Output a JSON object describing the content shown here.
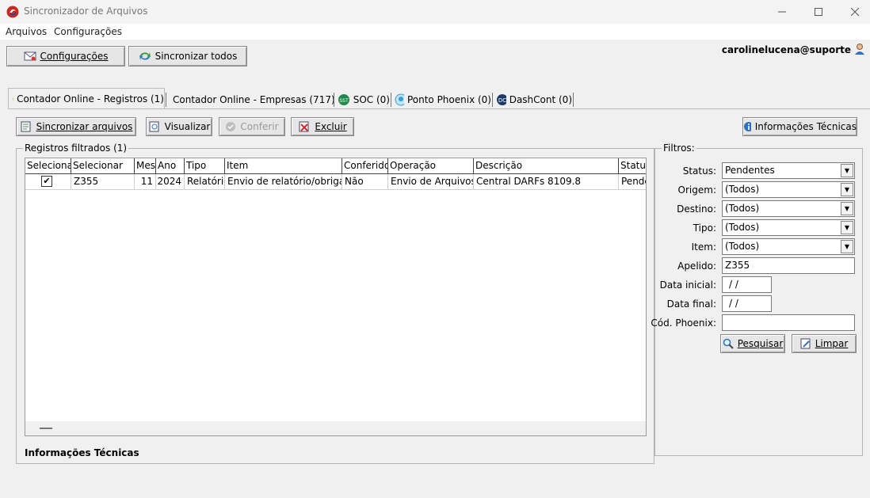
{
  "window": {
    "title": "Sincronizador de Arquivos"
  },
  "menu": [
    "Arquivos",
    "Configurações"
  ],
  "toolbar": {
    "config": "Configurações",
    "sync_all": "Sincronizar todos"
  },
  "user": "carolinelucena@suporte",
  "tabs": [
    {
      "label": "Contador Online - Registros (1)",
      "icon": "smiley-icon"
    },
    {
      "label": "Contador Online - Empresas (717)",
      "icon": "smiley-icon"
    },
    {
      "label": "SOC (0)",
      "icon": "soc-icon"
    },
    {
      "label": "Ponto Phoenix (0)",
      "icon": "phoenix-icon"
    },
    {
      "label": "DashCont (0)",
      "icon": "dashcont-icon"
    }
  ],
  "actions": {
    "sync_files": "Sincronizar arquivos",
    "view": "Visualizar",
    "check": "Conferir",
    "delete": "Excluir",
    "tech_info": "Informações Técnicas"
  },
  "records": {
    "legend": "Registros filtrados (1)",
    "columns": [
      "Selecionar",
      "Selecionar",
      "Mes",
      "Ano",
      "Tipo",
      "Item",
      "Conferido",
      "Operação",
      "Descrição",
      "Status"
    ],
    "rows": [
      [
        "✔",
        "Z355",
        "11",
        "2024",
        "Relatório",
        "Envio de relatório/obrigaçã",
        "Não",
        "Envio de Arquivos",
        "Central DARFs 8109.8",
        "Pende"
      ]
    ],
    "info_title": "Informações Técnicas"
  },
  "filters": {
    "legend": "Filtros:",
    "status_label": "Status:",
    "status_value": "Pendentes",
    "origem_label": "Origem:",
    "origem_value": "(Todos)",
    "destino_label": "Destino:",
    "destino_value": "(Todos)",
    "tipo_label": "Tipo:",
    "tipo_value": "(Todos)",
    "item_label": "Item:",
    "item_value": "(Todos)",
    "apelido_label": "Apelido:",
    "apelido_value": "Z355",
    "data_inicial_label": "Data inicial:",
    "data_inicial_value": "/ /",
    "data_final_label": "Data final:",
    "data_final_value": "/ /",
    "cod_label": "Cód. Phoenix:",
    "cod_value": "",
    "search": "Pesquisar",
    "clear": "Limpar"
  },
  "colors": {
    "window_bg": "#f0f0f0",
    "accent_blue": "#2f6fc2",
    "disabled_text": "#9a9a9a"
  }
}
